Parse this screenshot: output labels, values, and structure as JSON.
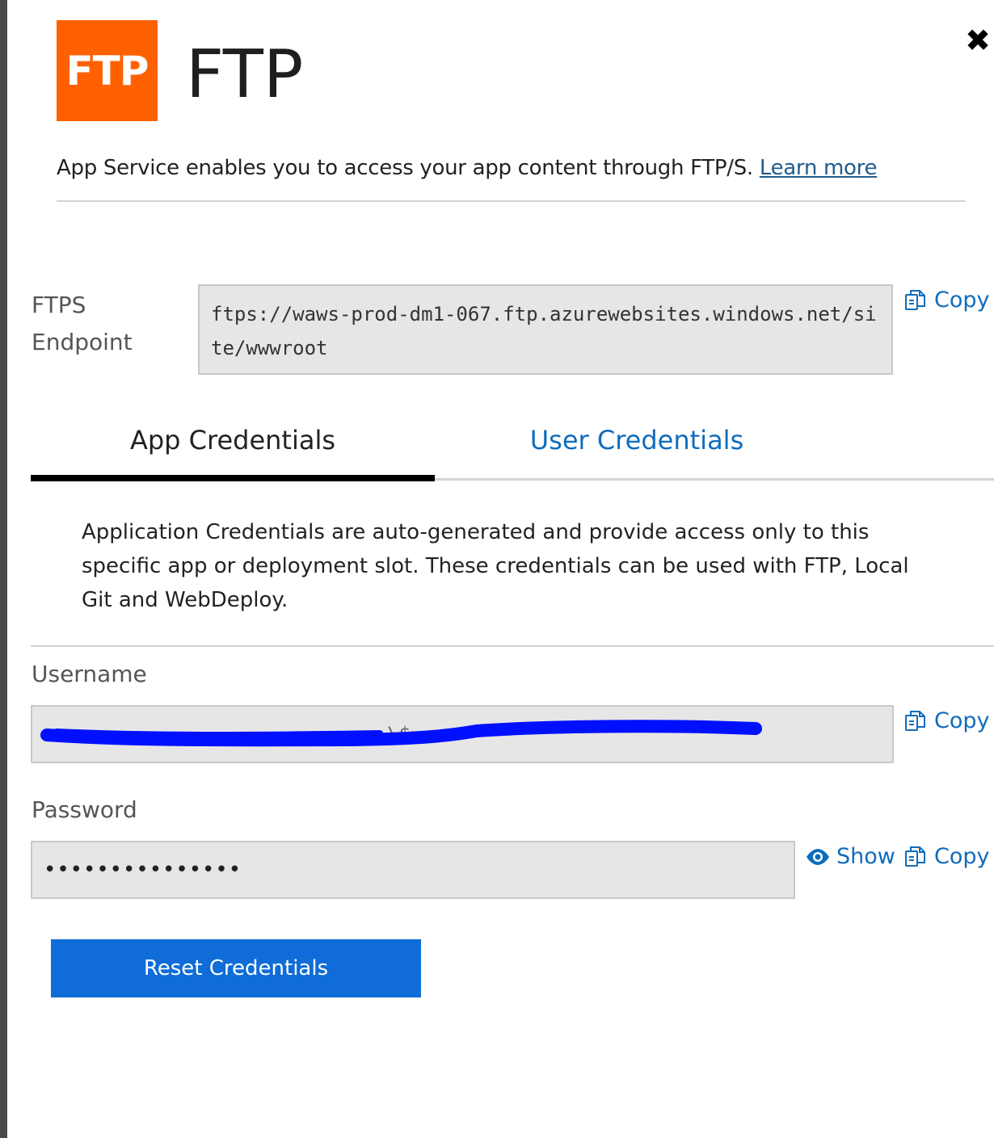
{
  "header": {
    "logo_text": "FTP",
    "title": "FTP",
    "close_icon": "close-icon"
  },
  "intro": {
    "text": "App Service enables you to access your app content through FTP/S.",
    "link": "Learn more"
  },
  "endpoint": {
    "label_line1": "FTPS",
    "label_line2": "Endpoint",
    "value": "ftps://waws-prod-dm1-067.ftp.azurewebsites.windows.net/site/wwwroot",
    "copy_label": "Copy"
  },
  "tabs": [
    {
      "label": "App Credentials",
      "active": true
    },
    {
      "label": "User Credentials",
      "active": false
    }
  ],
  "description": "Application Credentials are auto-generated and provide access only to this specific app or deployment slot. These credentials can be used with FTP, Local Git and WebDeploy.",
  "username": {
    "label": "Username",
    "value": "\\$",
    "copy_label": "Copy"
  },
  "password": {
    "label": "Password",
    "value": "•••••••••••••••",
    "show_label": "Show",
    "copy_label": "Copy"
  },
  "actions": {
    "reset_label": "Reset Credentials"
  },
  "colors": {
    "logo_bg": "#ff6000",
    "link": "#0f6cbd",
    "button_bg": "#0f6cd8",
    "redaction": "#0010ff"
  }
}
